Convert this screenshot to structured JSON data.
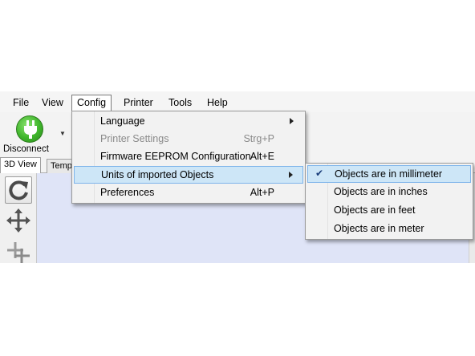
{
  "menubar": {
    "items": [
      {
        "label": "File"
      },
      {
        "label": "View"
      },
      {
        "label": "Config"
      },
      {
        "label": "Printer"
      },
      {
        "label": "Tools"
      },
      {
        "label": "Help"
      }
    ]
  },
  "toolbar": {
    "disconnect_label": "Disconnect",
    "dropdown_glyph": "▼"
  },
  "tabs": [
    {
      "label": "3D View"
    },
    {
      "label": "Temp"
    }
  ],
  "config_menu": {
    "items": [
      {
        "label": "Language",
        "shortcut": "",
        "submenu": true,
        "enabled": true
      },
      {
        "label": "Printer Settings",
        "shortcut": "Strg+P",
        "submenu": false,
        "enabled": false
      },
      {
        "label": "Firmware EEPROM Configuration",
        "shortcut": "Alt+E",
        "submenu": false,
        "enabled": true
      },
      {
        "label": "Units of imported Objects",
        "shortcut": "",
        "submenu": true,
        "enabled": true,
        "highlighted": true
      },
      {
        "label": "Preferences",
        "shortcut": "Alt+P",
        "submenu": false,
        "enabled": true
      }
    ]
  },
  "units_submenu": {
    "check_glyph": "✔",
    "items": [
      {
        "label": "Objects are in millimeter",
        "checked": true
      },
      {
        "label": "Objects are in inches",
        "checked": false
      },
      {
        "label": "Objects are in feet",
        "checked": false
      },
      {
        "label": "Objects are in meter",
        "checked": false
      }
    ]
  },
  "icons": {
    "toolbar": "plug-icon",
    "side": [
      "rotate-icon",
      "move-icon",
      "move-multiple-icon"
    ]
  },
  "colors": {
    "highlight": "#cde6f7",
    "highlight_border": "#7eb4ea",
    "view_background": "#dfe4f7",
    "connect_green": "#3fb52b"
  }
}
